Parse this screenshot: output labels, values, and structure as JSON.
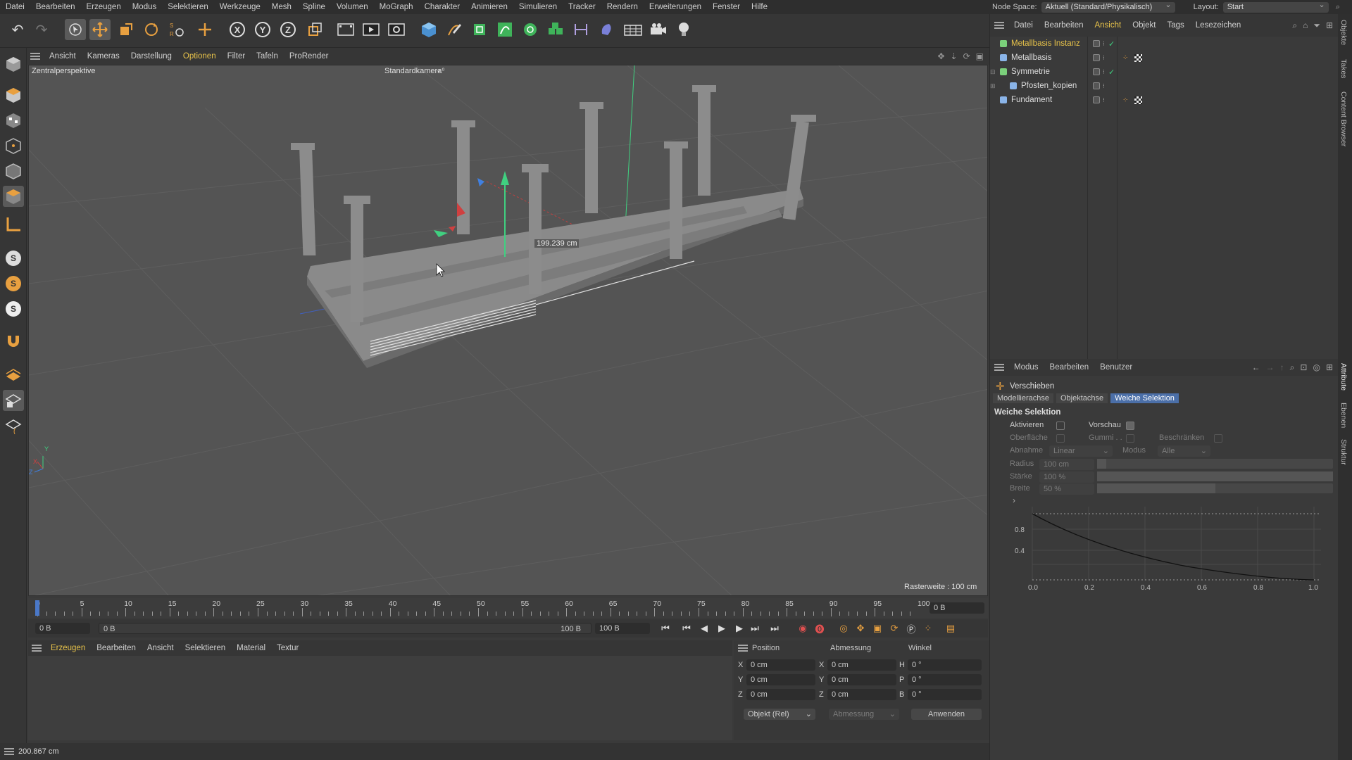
{
  "menubar": {
    "items": [
      "Datei",
      "Bearbeiten",
      "Erzeugen",
      "Modus",
      "Selektieren",
      "Werkzeuge",
      "Mesh",
      "Spline",
      "Volumen",
      "MoGraph",
      "Charakter",
      "Animieren",
      "Simulieren",
      "Tracker",
      "Rendern",
      "Erweiterungen",
      "Fenster",
      "Hilfe"
    ],
    "node_space_label": "Node Space:",
    "node_space_value": "Aktuell (Standard/Physikalisch)",
    "layout_label": "Layout:",
    "layout_value": "Start"
  },
  "toolbar": {
    "icons": [
      "undo-icon",
      "redo-icon",
      "select-arrow-icon",
      "move-icon",
      "scale-icon",
      "rotate-icon",
      "recent-tools-icon",
      "add-icon",
      "x-axis-lock-icon",
      "y-axis-lock-icon",
      "z-axis-lock-icon",
      "coordinate-system-icon",
      "render-region-icon",
      "render-view-icon",
      "render-settings-icon",
      "cube-icon",
      "pen-icon",
      "subdivision-icon",
      "spline-icon",
      "array-icon",
      "mograph-icon",
      "deformer-icon",
      "scene-icon",
      "floor-icon",
      "camera-icon",
      "light-icon"
    ],
    "axis_labels": [
      "X",
      "Y",
      "Z"
    ]
  },
  "viewport": {
    "menu": [
      "Ansicht",
      "Kameras",
      "Darstellung",
      "Optionen",
      "Filter",
      "Tafeln",
      "ProRender"
    ],
    "active_menu": "Optionen",
    "perspective_label": "Zentralperspektive",
    "camera_label": "Standardkamera",
    "measure_label": "199.239 cm",
    "grid_label": "Rasterweite : 100 cm",
    "axis_y": "Y",
    "axis_x": "X",
    "axis_z": "Z"
  },
  "timeline": {
    "ticks": [
      "0",
      "5",
      "10",
      "15",
      "20",
      "25",
      "30",
      "35",
      "40",
      "45",
      "50",
      "55",
      "60",
      "65",
      "70",
      "75",
      "80",
      "85",
      "90",
      "95",
      "100"
    ],
    "current_frame": "0 B"
  },
  "transport": {
    "start_field": "0 B",
    "range_start": "0 B",
    "range_end": "100 B",
    "end_field": "100 B"
  },
  "material": {
    "menu": [
      "Erzeugen",
      "Bearbeiten",
      "Ansicht",
      "Selektieren",
      "Material",
      "Textur"
    ]
  },
  "coords": {
    "headers": [
      "Position",
      "Abmessung",
      "Winkel"
    ],
    "rows": [
      {
        "axis": "X",
        "pos": "0 cm",
        "dim_axis": "X",
        "dim": "0 cm",
        "ang_axis": "H",
        "ang": "0 °"
      },
      {
        "axis": "Y",
        "pos": "0 cm",
        "dim_axis": "Y",
        "dim": "0 cm",
        "ang_axis": "P",
        "ang": "0 °"
      },
      {
        "axis": "Z",
        "pos": "0 cm",
        "dim_axis": "Z",
        "dim": "0 cm",
        "ang_axis": "B",
        "ang": "0 °"
      }
    ],
    "mode_select": "Objekt (Rel)",
    "size_select": "Abmessung",
    "apply_label": "Anwenden"
  },
  "status": {
    "text": "200.867 cm"
  },
  "objects": {
    "menu": [
      "Datei",
      "Bearbeiten",
      "Ansicht",
      "Objekt",
      "Tags",
      "Lesezeichen"
    ],
    "active_menu": "Ansicht",
    "items": [
      {
        "name": "Metallbasis Instanz",
        "indent": 0,
        "highlight": true,
        "icon": "instance-icon",
        "icon_color": "#7bd07b"
      },
      {
        "name": "Metallbasis",
        "indent": 0,
        "highlight": false,
        "icon": "connect-icon",
        "icon_color": "#8ab4e8"
      },
      {
        "name": "Symmetrie",
        "indent": 0,
        "highlight": false,
        "icon": "symmetry-icon",
        "icon_color": "#7bd07b"
      },
      {
        "name": "Pfosten_kopien",
        "indent": 1,
        "highlight": false,
        "icon": "null-icon",
        "icon_color": "#8ab4e8"
      },
      {
        "name": "Fundament",
        "indent": 0,
        "highlight": false,
        "icon": "connect-icon",
        "icon_color": "#8ab4e8"
      }
    ]
  },
  "attributes": {
    "menu": [
      "Modus",
      "Bearbeiten",
      "Benutzer"
    ],
    "tool_name": "Verschieben",
    "tabs": [
      "Modellierachse",
      "Objektachse",
      "Weiche Selektion"
    ],
    "active_tab": "Weiche Selektion",
    "section": "Weiche Selektion",
    "aktivieren": "Aktivieren",
    "vorschau": "Vorschau",
    "oberflaeche": "Oberfläche",
    "gummi": "Gummi . .",
    "beschraenken": "Beschränken",
    "abnahme_label": "Abnahme",
    "abnahme_value": "Linear",
    "modus_label": "Modus",
    "modus_value": "Alle",
    "radius_label": "Radius",
    "radius_value": "100 cm",
    "radius_fraction": 0.04,
    "staerke_label": "Stärke",
    "staerke_value": "100 %",
    "staerke_fraction": 1.0,
    "breite_label": "Breite",
    "breite_value": "50 %",
    "breite_fraction": 0.5,
    "graph_y_ticks": [
      "0.8",
      "0.4"
    ],
    "graph_x_ticks": [
      "0.0",
      "0.2",
      "0.4",
      "0.6",
      "0.8",
      "1.0"
    ]
  },
  "sidetabs": [
    "Objekte",
    "Takes",
    "Content Browser",
    "Attribute",
    "Ebenen",
    "Struktur"
  ],
  "colors": {
    "accent_yellow": "#e8c34a",
    "active_tab_blue": "#4b6fa8",
    "axis_green": "#40d080",
    "axis_red": "#d04040",
    "axis_blue": "#4080e0"
  }
}
